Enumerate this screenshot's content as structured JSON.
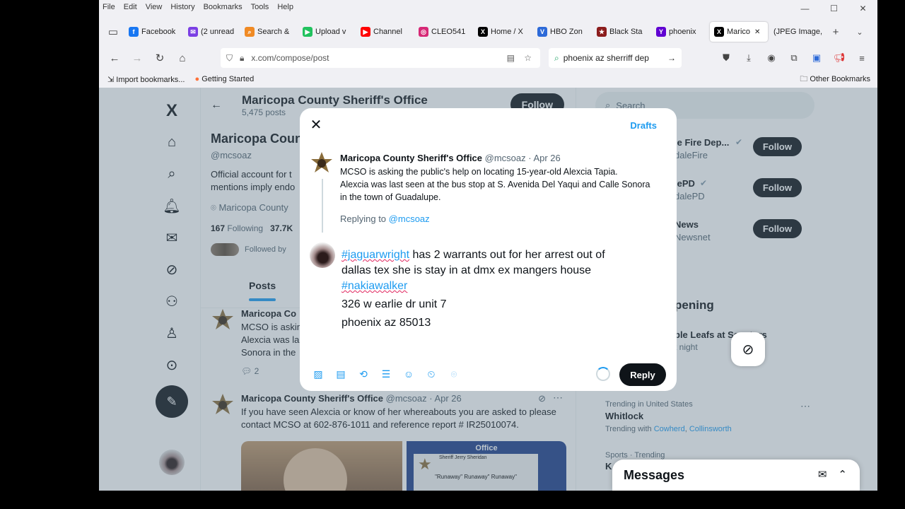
{
  "browser": {
    "menu": [
      "File",
      "Edit",
      "View",
      "History",
      "Bookmarks",
      "Tools",
      "Help"
    ],
    "tabs": [
      {
        "label": "Facebook",
        "color": "#1877f2",
        "glyph": "f"
      },
      {
        "label": "(2 unread",
        "color": "#7b3fe4",
        "glyph": "✉"
      },
      {
        "label": "Search &",
        "color": "#f08a24",
        "glyph": "⌕"
      },
      {
        "label": "Upload v",
        "color": "#21c25e",
        "glyph": "▶"
      },
      {
        "label": "Channel",
        "color": "#ff0000",
        "glyph": "▶"
      },
      {
        "label": "CLEO541",
        "color": "#d62976",
        "glyph": "◎"
      },
      {
        "label": "Home / X",
        "color": "#000000",
        "glyph": "X"
      },
      {
        "label": "HBO Zon",
        "color": "#2d6ad8",
        "glyph": "V"
      },
      {
        "label": "Black Sta",
        "color": "#8b1c1c",
        "glyph": "★"
      },
      {
        "label": "phoenix",
        "color": "#6001d2",
        "glyph": "Y"
      },
      {
        "label": "Marico",
        "color": "#000000",
        "glyph": "X",
        "active": true
      },
      {
        "label": "(JPEG Image,",
        "color": "transparent",
        "glyph": ""
      }
    ],
    "url": "x.com/compose/post",
    "search_text": "phoenix az  sherriff dep",
    "bookmarks": [
      "Import bookmarks...",
      "Getting Started"
    ],
    "other_bookmarks": "Other Bookmarks"
  },
  "profile": {
    "header_name": "Maricopa County Sheriff's Office",
    "posts_count": "5,475 posts",
    "follow_label": "Follow",
    "name": "Maricopa Coun",
    "handle": "@mcsoaz",
    "bio": "Official account for t mentions imply endo",
    "location": "Maricopa County",
    "following": "167",
    "following_label": "Following",
    "followers": "37.7K",
    "followed_by": "Followed by",
    "tab_posts": "Posts"
  },
  "timeline": [
    {
      "name": "Maricopa Co",
      "text": "MCSO is askin\n Alexcia was la\nSonora in the",
      "replies": "2"
    },
    {
      "name": "Maricopa County Sheriff's Office",
      "meta": "@mcsoaz · Apr 26",
      "text": "If you have seen Alexcia or know of her whereabouts you are asked to please contact MCSO at 602-876-1011 and reference report # IR25010074.",
      "poster_title": "Office",
      "poster_sub": "Sheriff Jerry Sheridan",
      "poster_caption": "\"Runaway\" Runaway\" Runaway\""
    }
  ],
  "sidebar": {
    "search_placeholder": "Search",
    "who_to_follow": [
      {
        "name": "le Fire Dep...",
        "handle": "daleFire"
      },
      {
        "name": "lePD",
        "handle": "dalePD"
      },
      {
        "name": "News",
        "handle": "Newsnet"
      }
    ],
    "follow_label": "Follow",
    "happening_title": "pening",
    "happening_item": "ple Leafs at Senators",
    "happening_sub": "t night",
    "trend_context": "Trending in United States",
    "trend_name": "Whitlock",
    "trend_with": "Trending with",
    "trend_people": [
      "Cowherd",
      "Collinsworth"
    ],
    "sports": "Sports · Trending",
    "sports_k": "K"
  },
  "messages_label": "Messages",
  "modal": {
    "drafts": "Drafts",
    "orig_name": "Maricopa County Sheriff's Office",
    "orig_meta": "@mcsoaz · Apr 26",
    "orig_text": "MCSO is asking the public's help on locating 15-year-old Alexcia Tapia.\n Alexcia was last seen at the bus stop at S. Avenida Del Yaqui and Calle Sonora in the town of Guadalupe.",
    "replying_to": "Replying to",
    "replying_handle": "@mcsoaz",
    "compose": {
      "tag1": "#jaguarwright",
      "line1_rest": " has 2 warrants out for her  arrest out of",
      "line2": "dallas tex she is stay in at dmx ex mangers house",
      "tag2": "#nakiawalker",
      "line4": "326 w earlie  dr unit 7",
      "line5": "phoenix az 85013"
    },
    "reply_label": "Reply"
  }
}
